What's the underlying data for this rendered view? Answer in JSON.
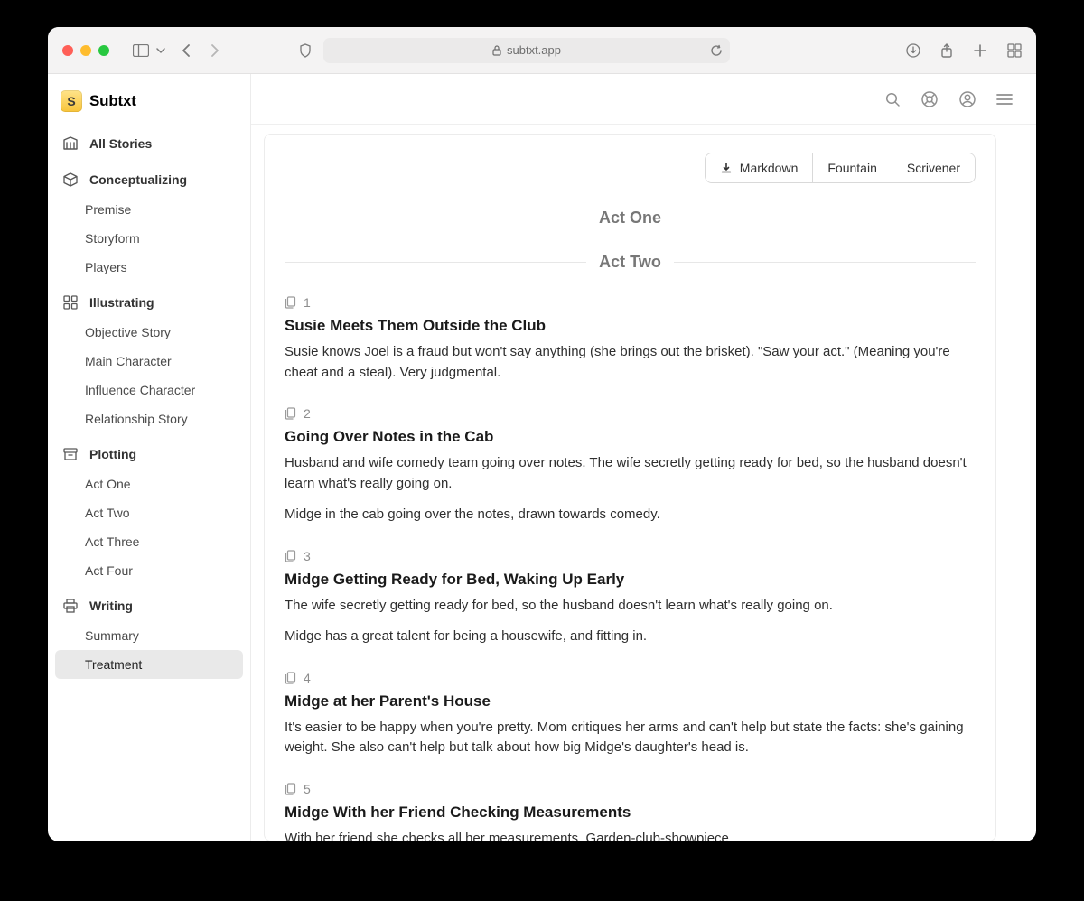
{
  "browser": {
    "address": "subtxt.app"
  },
  "app": {
    "brand": "Subtxt",
    "logo_letter": "S"
  },
  "sidebar": {
    "all_stories": "All Stories",
    "sections": {
      "conceptualizing": {
        "label": "Conceptualizing",
        "items": [
          "Premise",
          "Storyform",
          "Players"
        ]
      },
      "illustrating": {
        "label": "Illustrating",
        "items": [
          "Objective Story",
          "Main Character",
          "Influence Character",
          "Relationship Story"
        ]
      },
      "plotting": {
        "label": "Plotting",
        "items": [
          "Act One",
          "Act Two",
          "Act Three",
          "Act Four"
        ]
      },
      "writing": {
        "label": "Writing",
        "items": [
          "Summary",
          "Treatment"
        ],
        "active_index": 1
      }
    }
  },
  "export": {
    "markdown": "Markdown",
    "fountain": "Fountain",
    "scrivener": "Scrivener"
  },
  "acts": [
    {
      "label": "Act One",
      "scenes": []
    },
    {
      "label": "Act Two",
      "scenes": [
        {
          "num": "1",
          "title": "Susie Meets Them Outside the Club",
          "paras": [
            "Susie knows Joel is a fraud but won't say anything (she brings out the brisket). \"Saw your act.\" (Meaning you're cheat and a steal). Very judgmental."
          ]
        },
        {
          "num": "2",
          "title": "Going Over Notes in the Cab",
          "paras": [
            "Husband and wife comedy team going over notes. The wife secretly getting ready for bed, so the husband doesn't learn what's really going on.",
            "Midge in the cab going over the notes, drawn towards comedy."
          ]
        },
        {
          "num": "3",
          "title": "Midge Getting Ready for Bed, Waking Up Early",
          "paras": [
            "The wife secretly getting ready for bed, so the husband doesn't learn what's really going on.",
            "Midge has a great talent for being a housewife, and fitting in."
          ]
        },
        {
          "num": "4",
          "title": "Midge at her Parent's House",
          "paras": [
            "It's easier to be happy when you're pretty. Mom critiques her arms and can't help but state the facts: she's gaining weight. She also can't help but talk about how big Midge's daughter's head is."
          ]
        },
        {
          "num": "5",
          "title": "Midge With her Friend Checking Measurements",
          "paras": [
            "With her friend she checks all her measurements. Garden-club-showpiece."
          ]
        }
      ]
    }
  ]
}
